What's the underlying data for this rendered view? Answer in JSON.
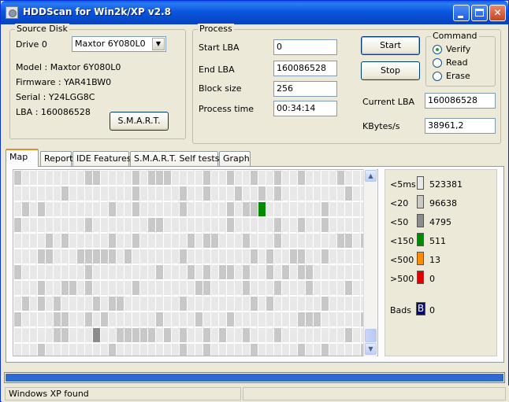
{
  "window": {
    "title": "HDDScan for Win2k/XP  v2.8",
    "controls": {
      "minimize": "minimize-icon",
      "maximize": "maximize-icon",
      "close": "✕"
    }
  },
  "source_disk": {
    "title": "Source Disk",
    "drive_label": "Drive  0",
    "drive_selected": "Maxtor 6Y080L0",
    "model": "Model : Maxtor 6Y080L0",
    "firmware": "Firmware : YAR41BW0",
    "serial": "Serial : Y24LGG8C",
    "lba": "LBA :  160086528",
    "smart_button": "S.M.A.R.T."
  },
  "process": {
    "title": "Process",
    "start_lba_label": "Start LBA",
    "start_lba": "0",
    "end_lba_label": "End LBA",
    "end_lba": "160086528",
    "block_size_label": "Block size",
    "block_size": "256",
    "process_time_label": "Process time",
    "process_time": "00:34:14",
    "start_button": "Start",
    "stop_button": "Stop",
    "current_lba_label": "Current LBA",
    "current_lba": "160086528",
    "kbytes_label": "KBytes/s",
    "kbytes": "38961,2"
  },
  "command": {
    "title": "Command",
    "options": [
      "Verify",
      "Read",
      "Erase"
    ],
    "selected": "Verify"
  },
  "tabs": [
    "Map",
    "Report",
    "IDE Features",
    "S.M.A.R.T. Self tests",
    "Graph"
  ],
  "active_tab": "Map",
  "map_grid": {
    "columns": 45,
    "rows": 12,
    "highlight_green": [
      31,
      2
    ],
    "highlight_gray": [
      10,
      10
    ]
  },
  "legend": {
    "items": [
      {
        "label": "<5ms",
        "count": "523381",
        "color": "#e8e8e8"
      },
      {
        "label": "<20",
        "count": "96638",
        "color": "#c8c8c8"
      },
      {
        "label": "<50",
        "count": "4795",
        "color": "#8c8c8c"
      },
      {
        "label": "<150",
        "count": "511",
        "color": "#008a00"
      },
      {
        "label": "<500",
        "count": "13",
        "color": "#ff8c00"
      },
      {
        "label": ">500",
        "count": "0",
        "color": "#e00000"
      }
    ],
    "bads_label": "Bads",
    "bads_glyph": "B",
    "bads_count": "0",
    "bads_color": "#0a0a6e"
  },
  "progress": {
    "value": 1.0
  },
  "statusbar": {
    "left": "Windows XP found",
    "right": ""
  }
}
